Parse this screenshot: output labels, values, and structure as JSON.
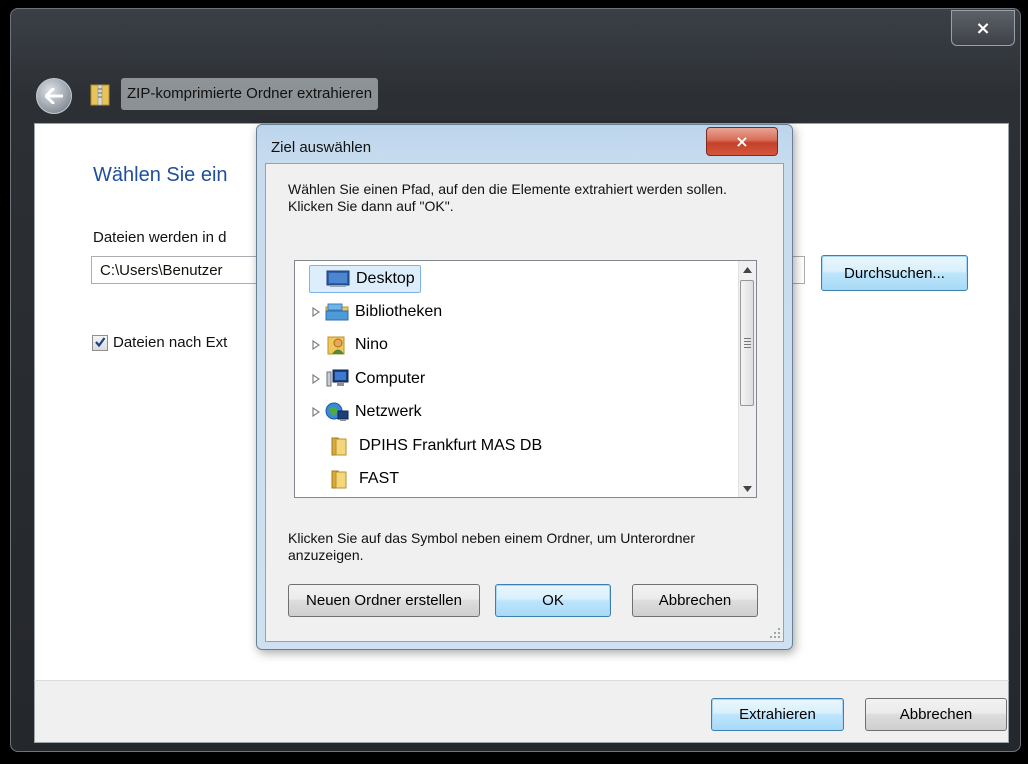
{
  "wizard": {
    "title": "ZIP-komprimierte Ordner extrahieren",
    "close_glyph": "×",
    "heading": "Wählen Sie ein",
    "path_label": "Dateien werden in d",
    "path_value": "C:\\Users\\Benutzer",
    "browse_label": "Durchsuchen...",
    "show_files_label": "Dateien nach Ext",
    "show_files_checked": true,
    "extract_label": "Extrahieren",
    "cancel_label": "Abbrechen"
  },
  "dialog": {
    "title": "Ziel auswählen",
    "close_glyph": "×",
    "instruction": "Wählen Sie einen Pfad, auf den die Elemente extrahiert werden sollen. Klicken Sie dann auf \"OK\".",
    "hint": "Klicken Sie auf das Symbol neben einem Ordner, um Unterordner anzuzeigen.",
    "new_folder_label": "Neuen Ordner erstellen",
    "ok_label": "OK",
    "cancel_label": "Abbrechen",
    "tree": [
      {
        "label": "Desktop",
        "icon": "desktop-icon",
        "expandable": false,
        "selected": true
      },
      {
        "label": "Bibliotheken",
        "icon": "libraries-icon",
        "expandable": true,
        "selected": false
      },
      {
        "label": "Nino",
        "icon": "user-folder-icon",
        "expandable": true,
        "selected": false
      },
      {
        "label": "Computer",
        "icon": "computer-icon",
        "expandable": true,
        "selected": false
      },
      {
        "label": "Netzwerk",
        "icon": "network-icon",
        "expandable": true,
        "selected": false
      },
      {
        "label": "DPIHS Frankfurt MAS DB",
        "icon": "folder-icon",
        "expandable": false,
        "selected": false
      },
      {
        "label": "FAST",
        "icon": "folder-icon",
        "expandable": false,
        "selected": false
      }
    ]
  },
  "colors": {
    "heading_blue": "#1e4e9c",
    "close_red": "#c3412a",
    "selection_bg": "#dceefc"
  }
}
